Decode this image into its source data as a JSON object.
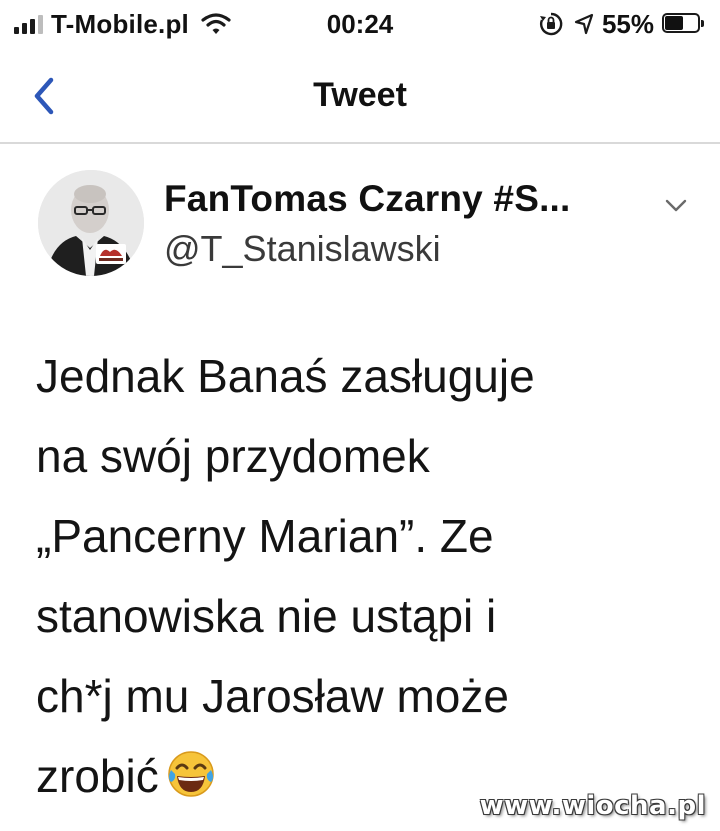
{
  "status_bar": {
    "carrier": "T-Mobile.pl",
    "time": "00:24",
    "battery_percent": "55%",
    "battery_level": 0.55,
    "icons": [
      "signal-icon",
      "wifi-icon",
      "lock-rotation-icon",
      "location-icon",
      "battery-icon"
    ]
  },
  "nav": {
    "title": "Tweet",
    "back_icon": "chevron-left-icon"
  },
  "tweet": {
    "display_name": "FanTomas Czarny #S...",
    "username": "@T_Stanislawski",
    "caret_icon": "chevron-down-icon",
    "body_lines": [
      "Jednak Banaś zasługuje",
      "na swój przydomek",
      "„Pancerny Marian”. Ze",
      "stanowiska nie ustąpi i",
      "ch*j mu Jarosław może",
      "zrobić"
    ],
    "emoji": "face-with-tears-of-joy-icon"
  },
  "watermark": "www.wiocha.pl",
  "colors": {
    "text": "#141414",
    "back_chevron": "#2d57b8",
    "divider": "#d9d9d9",
    "emoji_face": "#f6c43a"
  }
}
